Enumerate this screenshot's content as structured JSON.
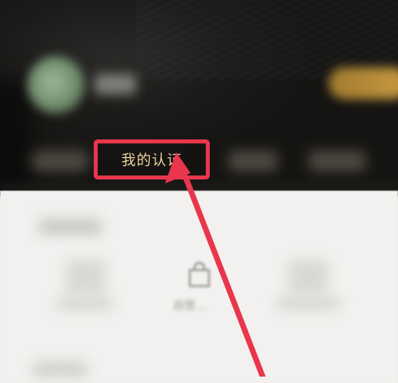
{
  "profile": {
    "certification_button_label": "我的认证"
  },
  "feature_grid": {
    "items": [
      {
        "icon": "shopping-bag-icon",
        "label": "自营..."
      }
    ]
  },
  "annotation": {
    "highlight_color": "#e8364d",
    "arrow_color": "#e8364d"
  },
  "colors": {
    "header_bg": "#1b1a18",
    "accent_gold": "#e9d3a0",
    "card_bg": "#f2f1ef"
  }
}
